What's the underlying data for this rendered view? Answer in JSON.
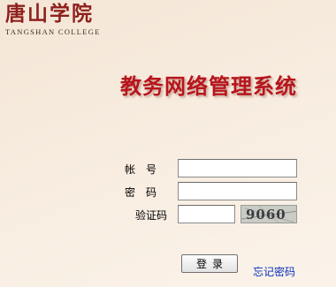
{
  "logo": {
    "name_cn": "唐山学院",
    "name_en": "TANGSHAN COLLEGE"
  },
  "title": "教务网络管理系统",
  "form": {
    "account_label": "帐　号",
    "password_label": "密　码",
    "captcha_label": "验证码",
    "account_value": "",
    "password_value": "",
    "captcha_value": "",
    "captcha_code": "9060"
  },
  "actions": {
    "login_label": "登录",
    "forgot_label": "忘记密码"
  },
  "colors": {
    "title": "#b8141c",
    "logo": "#8e1f1c",
    "link": "#0a2fbf"
  }
}
